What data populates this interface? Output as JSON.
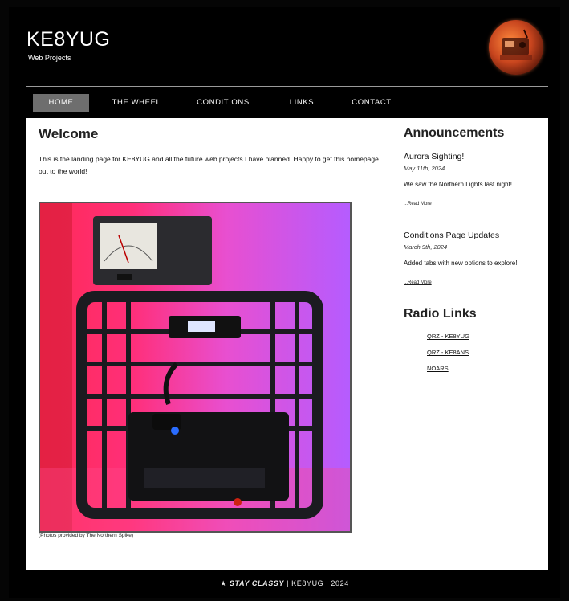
{
  "header": {
    "title": "KE8YUG",
    "subtitle": "Web Projects"
  },
  "nav": [
    {
      "label": "HOME",
      "active": true
    },
    {
      "label": "THE WHEEL",
      "active": false
    },
    {
      "label": "CONDITIONS",
      "active": false
    },
    {
      "label": "LINKS",
      "active": false
    },
    {
      "label": "CONTACT",
      "active": false
    }
  ],
  "main": {
    "title": "Welcome",
    "text": "This is the landing page for KE8YUG and all the future web projects I have planned. Happy to get this homepage out to the world!",
    "caption_prefix": "(Photos provided by ",
    "caption_link": "The Northern Spike",
    "caption_suffix": ")"
  },
  "sidebar": {
    "announcements_heading": "Announcements",
    "announcements": [
      {
        "title": "Aurora Sighting!",
        "date": "May 11th, 2024",
        "text": "We saw the Northern Lights last night!",
        "read_more": "...Read More"
      },
      {
        "title": "Conditions Page Updates",
        "date": "March 9th, 2024",
        "text": "Added tabs with new options to explore!",
        "read_more": "...Read More"
      }
    ],
    "radio_heading": "Radio Links",
    "radio_links": [
      "QRZ - KE8YUG",
      "QRZ - KE8ANS",
      "NOARS"
    ]
  },
  "footer": {
    "brand": "STAY CLASSY",
    "rest": " | KE8YUG | 2024"
  },
  "colors": {
    "background": "#000000",
    "content": "#ffffff",
    "nav_active": "#6e6e6e"
  }
}
